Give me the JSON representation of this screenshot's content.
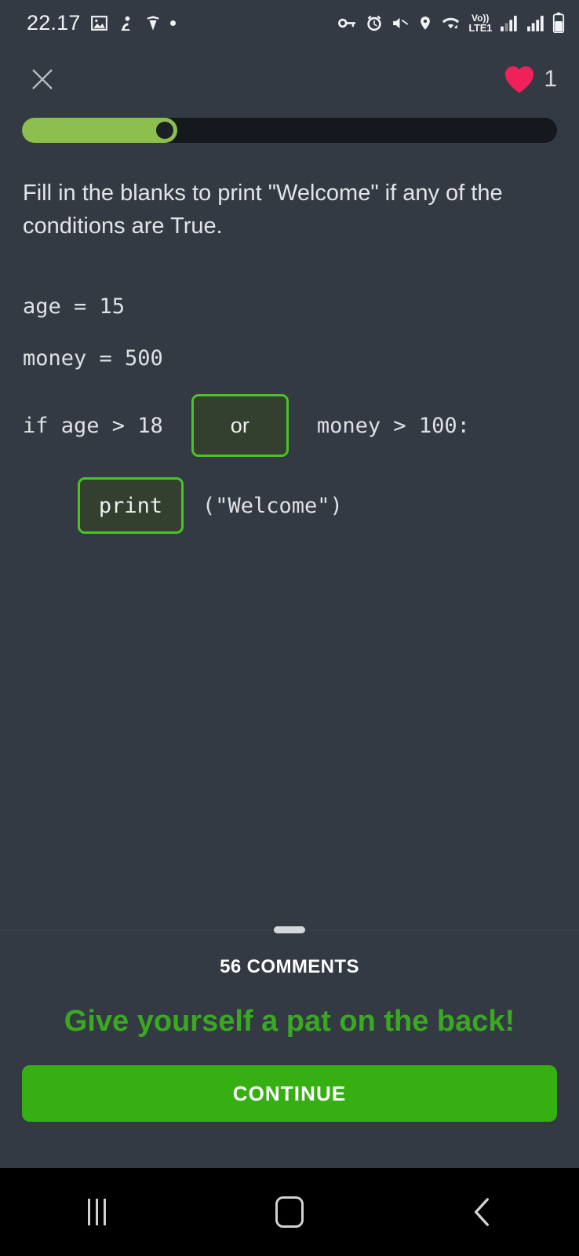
{
  "statusbar": {
    "time": "22.17",
    "left_icons": [
      "image-icon",
      "app-icon",
      "shield-icon",
      "dot-icon"
    ],
    "right_icons": [
      "vpn-key-icon",
      "alarm-icon",
      "mute-icon",
      "location-icon",
      "wifi-icon"
    ],
    "network_label_top": "Vo))",
    "network_label_bottom": "LTE1",
    "signal_icons": [
      "signal-bars-1-icon",
      "signal-bars-2-icon"
    ],
    "battery_icon": "battery-icon"
  },
  "header": {
    "close_icon": "close-icon",
    "heart_icon": "heart-icon",
    "heart_count": "1",
    "heart_color": "#f0215a"
  },
  "progress": {
    "percent": 29,
    "fill_color": "#8cbf4d",
    "track_color": "#15181d"
  },
  "question": {
    "text": "Fill in the blanks to print \"Welcome\" if any of the conditions are True."
  },
  "code": {
    "line1": "age = 15",
    "line2": "money = 500",
    "line3_before": "if age > 18",
    "blank1_value": "or",
    "line3_after": "money > 100:",
    "blank2_value": "print",
    "line4_after": "(\"Welcome\")"
  },
  "bottom": {
    "comments_label": "56 COMMENTS",
    "praise_text": "Give yourself a pat on the back!",
    "continue_label": "CONTINUE",
    "praise_color": "#39aa20",
    "continue_color": "#35af12"
  },
  "navbar": {
    "recents": "recents-icon",
    "home": "home-icon",
    "back": "back-icon"
  }
}
